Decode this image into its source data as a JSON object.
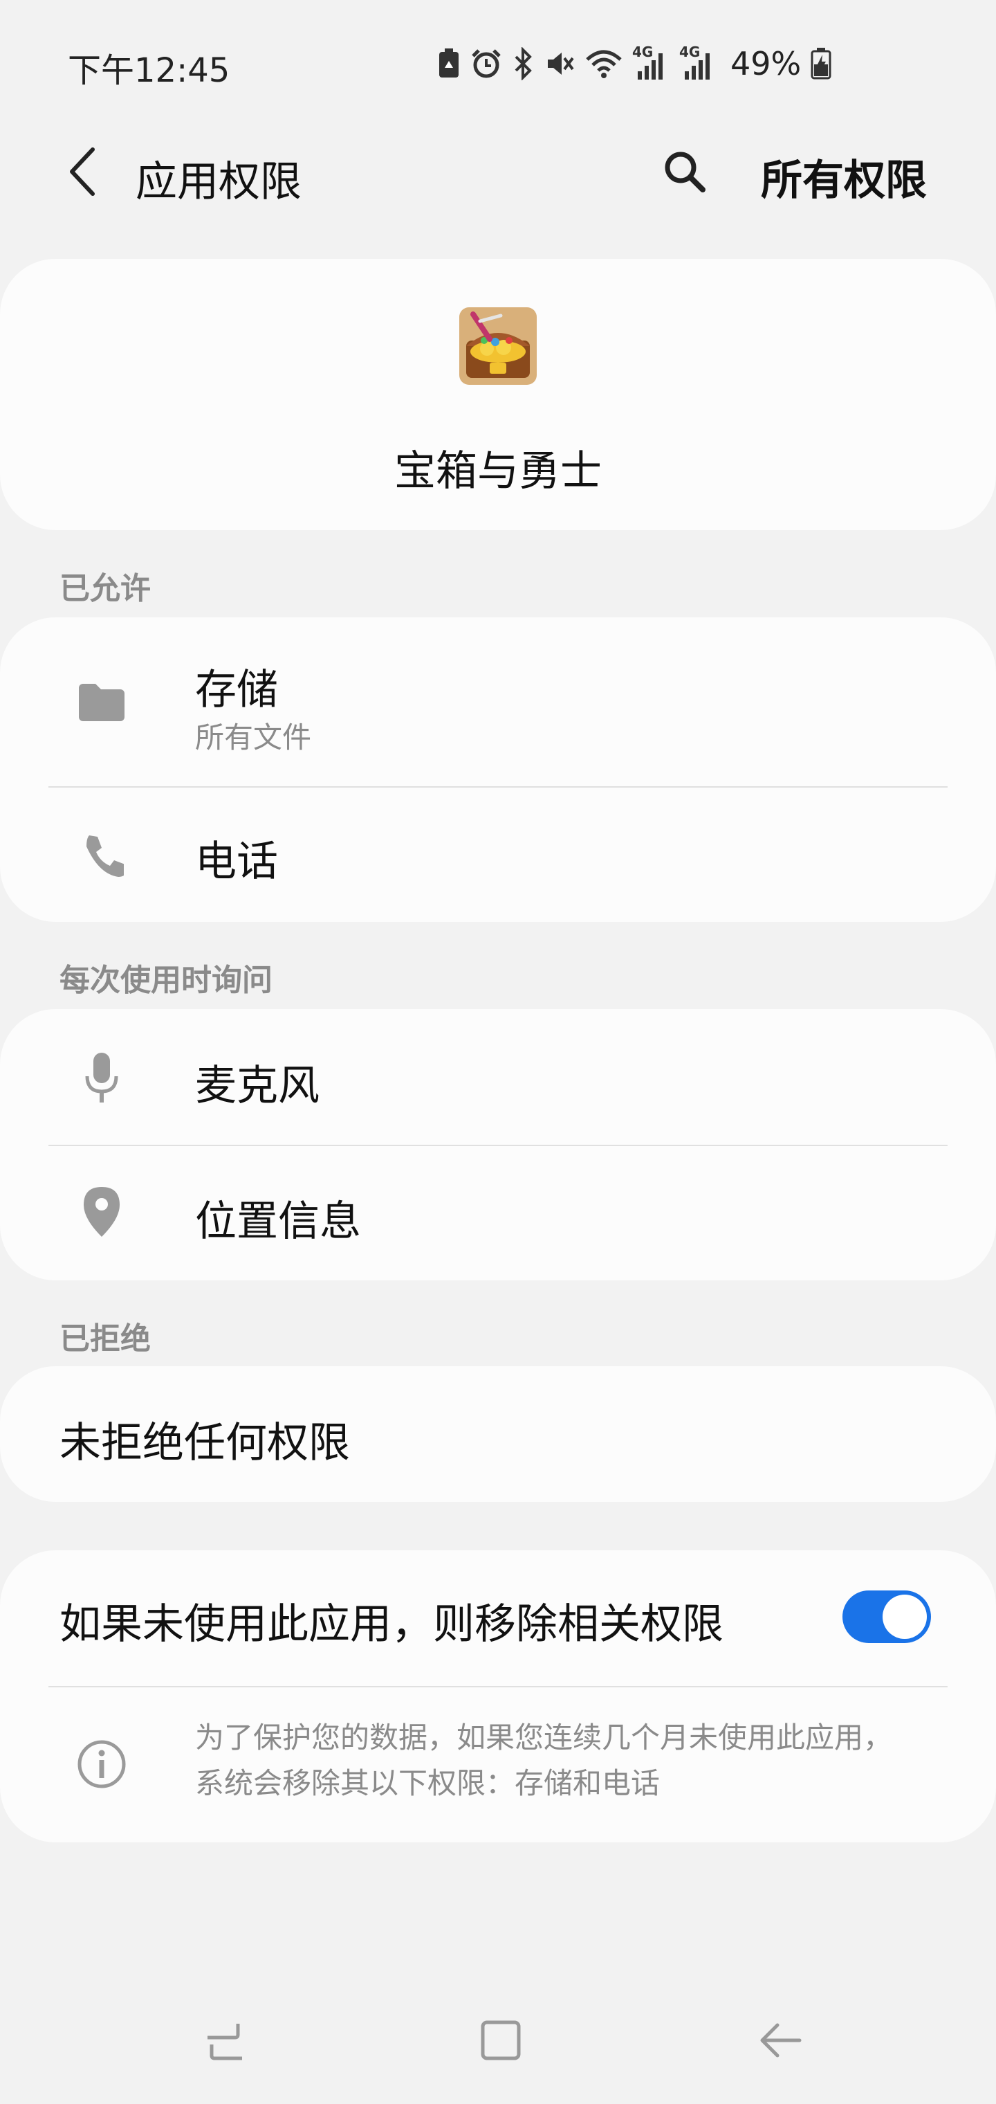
{
  "status_bar": {
    "time": "下午12:45",
    "battery_percent": "49%",
    "icons": [
      "battery-saver-icon",
      "alarm-icon",
      "bluetooth-icon",
      "mute-icon",
      "wifi-icon",
      "signal-4g-icon",
      "signal-4g-icon",
      "battery-charging-icon"
    ],
    "network_label_1": "4G",
    "network_label_2": "4G"
  },
  "header": {
    "title": "应用权限",
    "action_label": "所有权限"
  },
  "app": {
    "name": "宝箱与勇士",
    "icon": "treasure-chest-app-icon"
  },
  "sections": {
    "allowed": {
      "label": "已允许",
      "items": [
        {
          "title": "存储",
          "subtitle": "所有文件",
          "icon": "folder-icon"
        },
        {
          "title": "电话",
          "icon": "phone-icon"
        }
      ]
    },
    "ask": {
      "label": "每次使用时询问",
      "items": [
        {
          "title": "麦克风",
          "icon": "microphone-icon"
        },
        {
          "title": "位置信息",
          "icon": "location-icon"
        }
      ]
    },
    "denied": {
      "label": "已拒绝",
      "empty_text": "未拒绝任何权限"
    }
  },
  "auto_revoke": {
    "label": "如果未使用此应用，则移除相关权限",
    "enabled": true,
    "info_line_1": "为了保护您的数据，如果您连续几个月未使用此应用，",
    "info_line_2": "系统会移除其以下权限：存储和电话"
  },
  "colors": {
    "background": "#f2f2f2",
    "card": "#fcfcfc",
    "accent": "#1a73e8",
    "secondary_text": "#8a8a8a"
  }
}
